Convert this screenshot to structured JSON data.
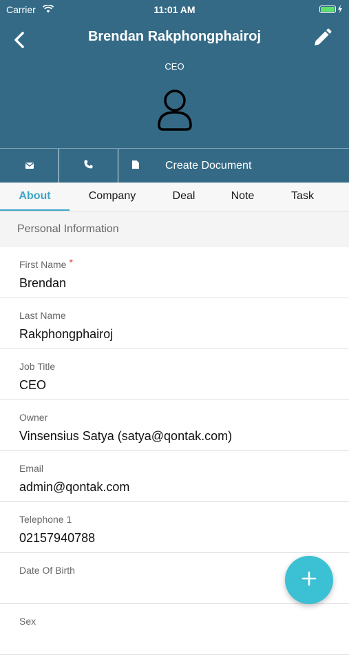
{
  "status_bar": {
    "carrier": "Carrier",
    "time": "11:01 AM"
  },
  "header": {
    "title": "Brendan Rakphongphairoj",
    "job_title": "CEO"
  },
  "actions": {
    "create_document": "Create Document"
  },
  "tabs": [
    {
      "label": "About",
      "active": true
    },
    {
      "label": "Company",
      "active": false
    },
    {
      "label": "Deal",
      "active": false
    },
    {
      "label": "Note",
      "active": false
    },
    {
      "label": "Task",
      "active": false
    }
  ],
  "section": {
    "title": "Personal Information"
  },
  "fields": [
    {
      "label": "First Name",
      "value": "Brendan",
      "required": "*"
    },
    {
      "label": "Last Name",
      "value": "Rakphongphairoj"
    },
    {
      "label": "Job Title",
      "value": "CEO"
    },
    {
      "label": "Owner",
      "value": "Vinsensius Satya (satya@qontak.com)"
    },
    {
      "label": "Email",
      "value": "admin@qontak.com"
    },
    {
      "label": "Telephone 1",
      "value": "02157940788"
    },
    {
      "label": "Date Of Birth",
      "value": ""
    },
    {
      "label": "Sex",
      "value": ""
    }
  ],
  "colors": {
    "header": "#346a86",
    "accent": "#3aa5c6",
    "fab": "#3cc0d4",
    "required": "#e53935"
  },
  "icons": [
    "back-icon",
    "edit-icon",
    "avatar-icon",
    "mail-icon",
    "phone-icon",
    "document-icon",
    "plus-icon"
  ]
}
